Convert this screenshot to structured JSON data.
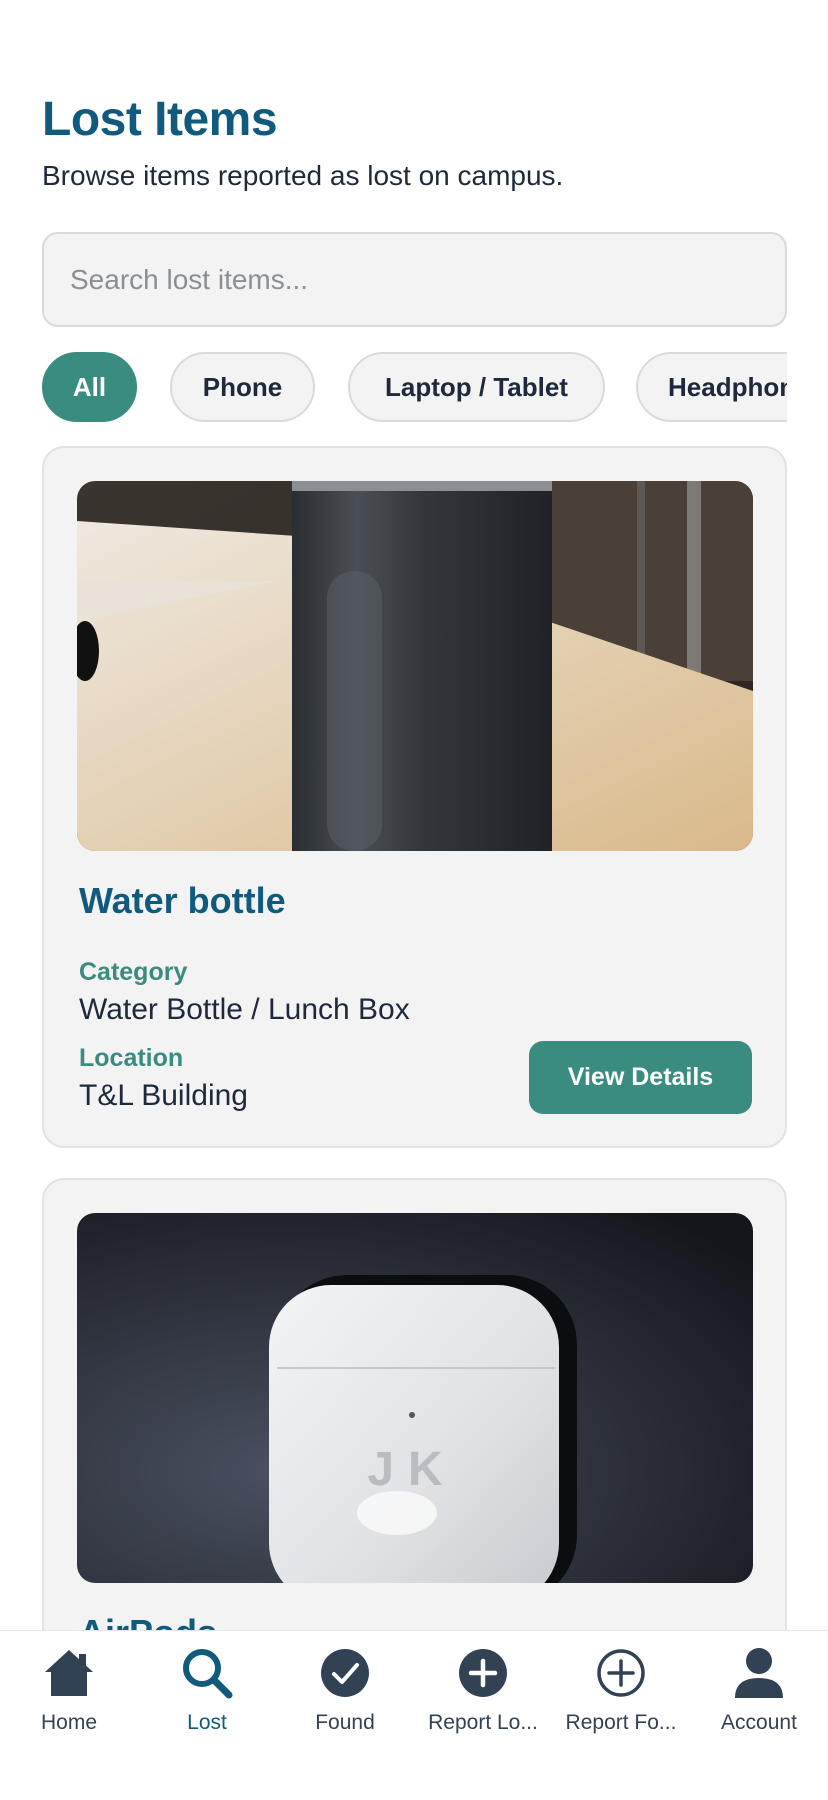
{
  "header": {
    "title": "Lost Items",
    "subtitle": "Browse items reported as lost on campus."
  },
  "search": {
    "placeholder": "Search lost items...",
    "value": ""
  },
  "filters": [
    {
      "label": "All",
      "active": true
    },
    {
      "label": "Phone",
      "active": false
    },
    {
      "label": "Laptop / Tablet",
      "active": false
    },
    {
      "label": "Headphones",
      "active": false
    }
  ],
  "items": [
    {
      "name": "Water bottle",
      "category_label": "Category",
      "category": "Water Bottle / Lunch Box",
      "location_label": "Location",
      "location": "T&L Building",
      "button": "View Details",
      "photo": "water-bottle-photo"
    },
    {
      "name": "AirPods",
      "photo": "airpods-photo",
      "engraving": "JK"
    }
  ],
  "tabbar": [
    {
      "label": "Home",
      "icon": "home-icon",
      "active": false
    },
    {
      "label": "Lost",
      "icon": "search-icon",
      "active": true
    },
    {
      "label": "Found",
      "icon": "check-circle-icon",
      "active": false
    },
    {
      "label": "Report Lo...",
      "icon": "plus-circle-filled-icon",
      "active": false
    },
    {
      "label": "Report Fo...",
      "icon": "plus-circle-outline-icon",
      "active": false
    },
    {
      "label": "Account",
      "icon": "user-icon",
      "active": false
    }
  ],
  "colors": {
    "brand": "#0f5a7d",
    "accent": "#3a8c80",
    "text": "#1e293b"
  }
}
